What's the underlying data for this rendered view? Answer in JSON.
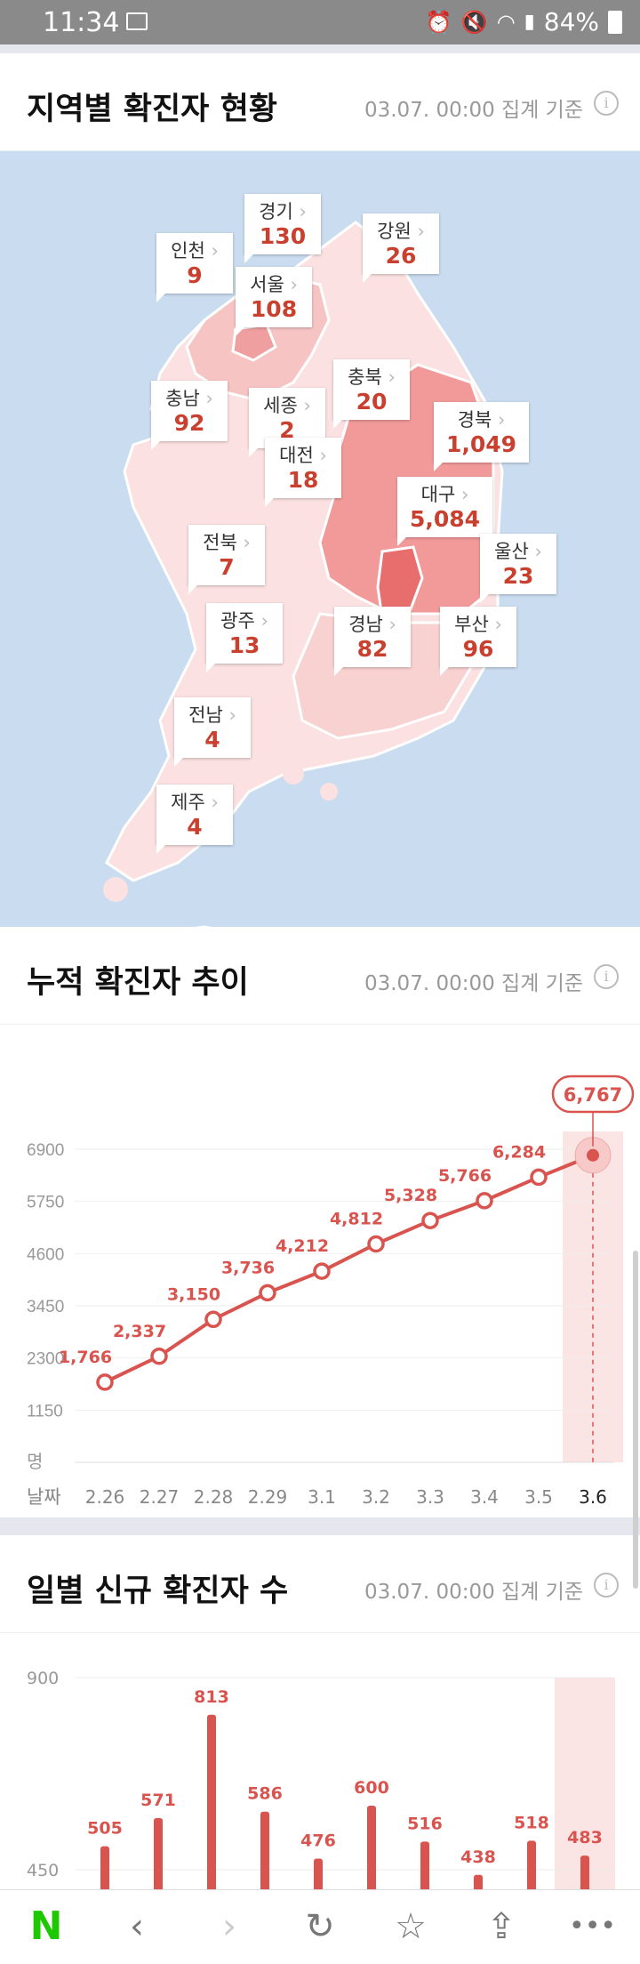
{
  "status": {
    "time": "11:34",
    "battery": "84%"
  },
  "regional": {
    "title": "지역별 확진자 현황",
    "meta": "03.07. 00:00 집계 기준",
    "regions": [
      {
        "name": "경기",
        "count": "130"
      },
      {
        "name": "인천",
        "count": "9"
      },
      {
        "name": "강원",
        "count": "26"
      },
      {
        "name": "서울",
        "count": "108"
      },
      {
        "name": "충북",
        "count": "20"
      },
      {
        "name": "충남",
        "count": "92"
      },
      {
        "name": "세종",
        "count": "2"
      },
      {
        "name": "경북",
        "count": "1,049"
      },
      {
        "name": "대전",
        "count": "18"
      },
      {
        "name": "대구",
        "count": "5,084"
      },
      {
        "name": "전북",
        "count": "7"
      },
      {
        "name": "울산",
        "count": "23"
      },
      {
        "name": "광주",
        "count": "13"
      },
      {
        "name": "경남",
        "count": "82"
      },
      {
        "name": "부산",
        "count": "96"
      },
      {
        "name": "전남",
        "count": "4"
      },
      {
        "name": "제주",
        "count": "4"
      }
    ]
  },
  "cumulative": {
    "title": "누적 확진자 추이",
    "meta": "03.07. 00:00 집계 기준",
    "unit": "명",
    "xlabel": "날짜",
    "highlight_label": "6,767",
    "chart_data": {
      "type": "line",
      "categories": [
        "2.26",
        "2.27",
        "2.28",
        "2.29",
        "3.1",
        "3.2",
        "3.3",
        "3.4",
        "3.5",
        "3.6"
      ],
      "values": [
        1766,
        2337,
        3150,
        3736,
        4212,
        4812,
        5328,
        5766,
        6284,
        6767
      ],
      "value_labels": [
        "1,766",
        "2,337",
        "3,150",
        "3,736",
        "4,212",
        "4,812",
        "5,328",
        "5,766",
        "6,284",
        "6,767"
      ],
      "yticks": [
        "6900",
        "5750",
        "4600",
        "3450",
        "2300",
        "1150"
      ],
      "ylim": [
        0,
        6900
      ],
      "color": "#d9534f"
    }
  },
  "daily": {
    "title": "일별 신규 확진자 수",
    "meta": "03.07. 00:00 집계 기준",
    "chart_data": {
      "type": "bar",
      "values": [
        505,
        571,
        813,
        586,
        476,
        600,
        516,
        438,
        518,
        483
      ],
      "value_labels": [
        "505",
        "571",
        "813",
        "586",
        "476",
        "600",
        "516",
        "438",
        "518",
        "483"
      ],
      "yticks": [
        "900",
        "450"
      ],
      "ylim": [
        0,
        900
      ],
      "color": "#d9534f"
    }
  },
  "colors": {
    "accent": "#d9534f",
    "map_sea": "#cadcef",
    "daegu": "#ee8a8a",
    "gyeongbuk": "#f29a9a"
  }
}
